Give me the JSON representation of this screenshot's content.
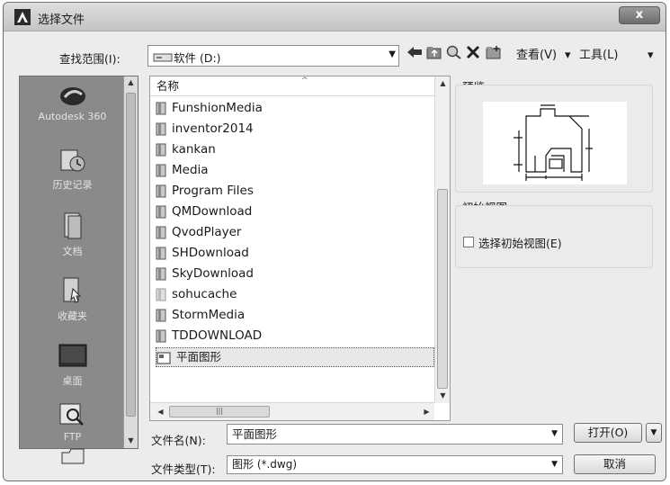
{
  "window": {
    "title": "选择文件",
    "close_label": "x"
  },
  "lookin": {
    "label": "查找范围(I):",
    "value": "软件 (D:)"
  },
  "toolbar": {
    "view_label": "查看(V)",
    "tools_label": "工具(L)"
  },
  "places": [
    {
      "label": "Autodesk 360",
      "icon": "cloud-icon"
    },
    {
      "label": "历史记录",
      "icon": "history-icon"
    },
    {
      "label": "文档",
      "icon": "documents-icon"
    },
    {
      "label": "收藏夹",
      "icon": "favorites-icon"
    },
    {
      "label": "桌面",
      "icon": "desktop-icon"
    },
    {
      "label": "FTP",
      "icon": "ftp-icon"
    }
  ],
  "filelist": {
    "header": "名称",
    "items": [
      "FunshionMedia",
      "inventor2014",
      "kankan",
      "Media",
      "Program Files",
      "QMDownload",
      "QvodPlayer",
      "SHDownload",
      "SkyDownload",
      "sohucache",
      "StormMedia",
      "TDDOWNLOAD"
    ],
    "selected": "平面图形"
  },
  "preview": {
    "label": "预览"
  },
  "initial_view": {
    "label": "初始视图",
    "checkbox_label": "选择初始视图(E)",
    "checked": false
  },
  "filename": {
    "label": "文件名(N):",
    "value": "平面图形"
  },
  "filetype": {
    "label": "文件类型(T):",
    "value": "图形 (*.dwg)"
  },
  "buttons": {
    "open": "打开(O)",
    "cancel": "取消"
  }
}
